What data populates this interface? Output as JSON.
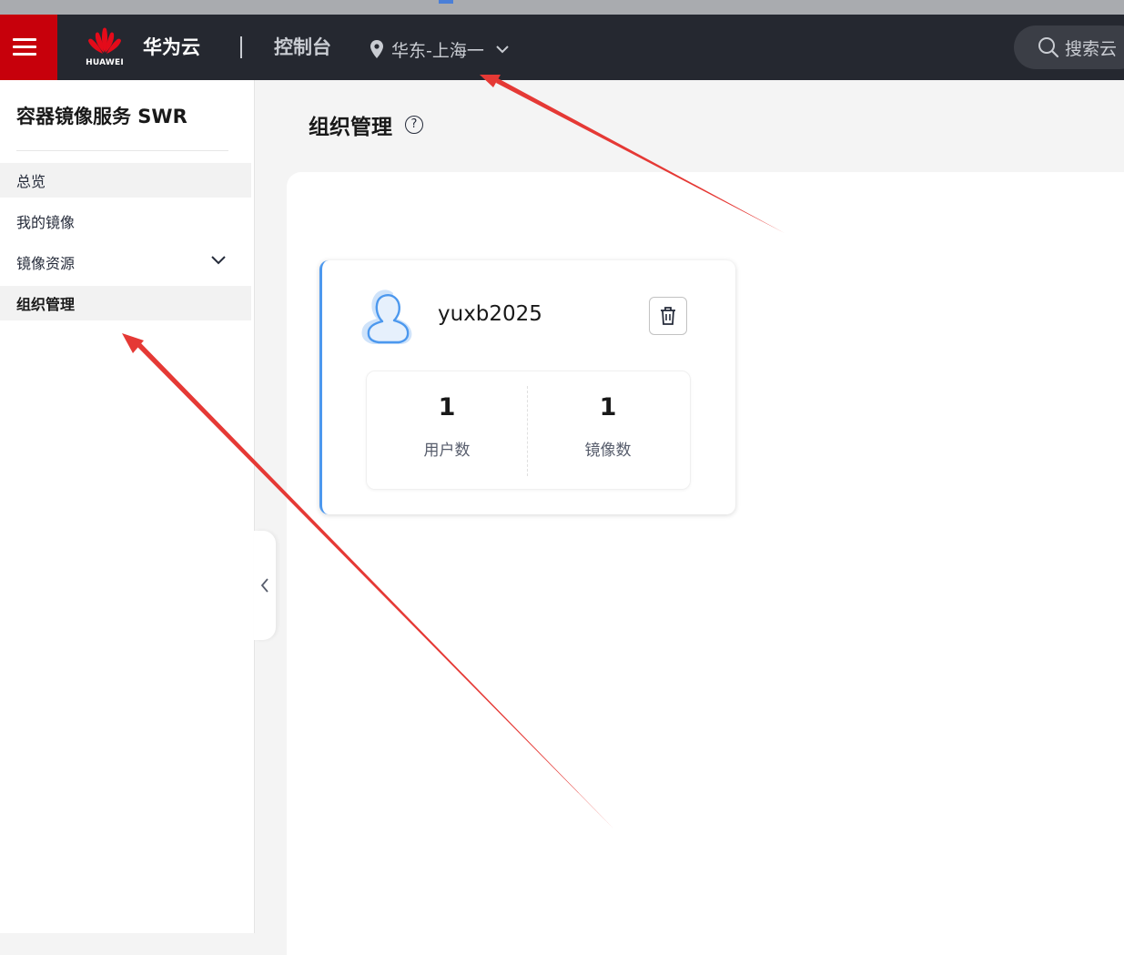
{
  "header": {
    "brand": "华为云",
    "logo_text": "HUAWEI",
    "console": "控制台",
    "region": "华东-上海一",
    "search_placeholder": "搜索云"
  },
  "sidebar": {
    "title": "容器镜像服务 SWR",
    "items": [
      {
        "label": "总览"
      },
      {
        "label": "我的镜像"
      },
      {
        "label": "镜像资源"
      },
      {
        "label": "组织管理"
      }
    ]
  },
  "main": {
    "page_title": "组织管理",
    "help_symbol": "?",
    "organizations": [
      {
        "name": "yuxb2025",
        "users_count": "1",
        "users_label": "用户数",
        "images_count": "1",
        "images_label": "镜像数"
      }
    ]
  },
  "colors": {
    "header_bg": "#252830",
    "brand_red": "#c7000b",
    "card_accent": "#4c98ee",
    "annotation_arrow": "#e53935"
  },
  "icons": [
    "menu-icon",
    "huawei-logo",
    "location-pin-icon",
    "chevron-down-icon",
    "search-icon",
    "help-icon",
    "user-avatar-icon",
    "trash-icon",
    "chevron-left-icon"
  ]
}
